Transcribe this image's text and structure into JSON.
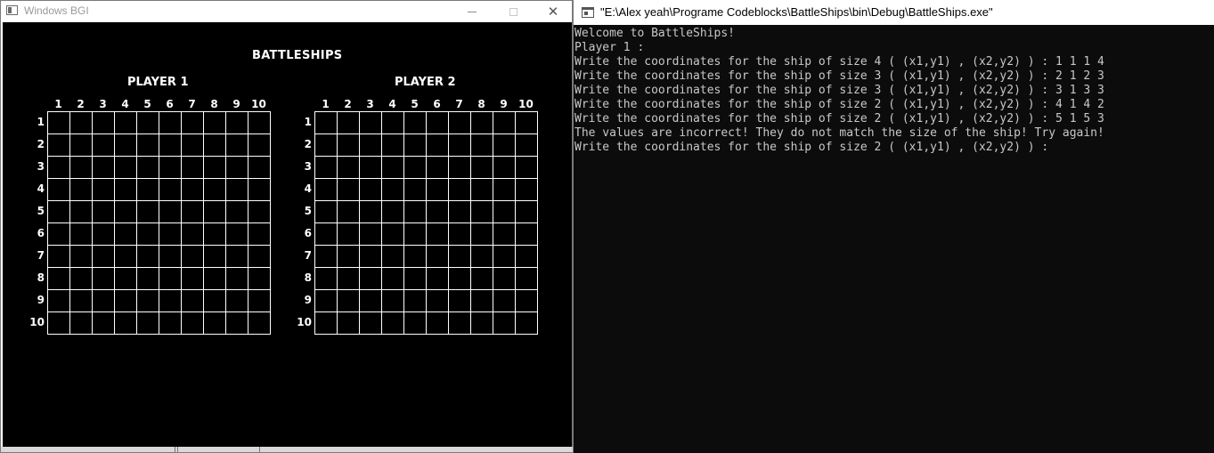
{
  "bgi_window": {
    "title": "Windows BGI",
    "controls": {
      "minimize": "—",
      "maximize": "☐",
      "close": "✕"
    },
    "game_title": "BATTLESHIPS",
    "players": [
      {
        "label": "PLAYER 1"
      },
      {
        "label": "PLAYER 2"
      }
    ],
    "column_numbers": [
      "1",
      "2",
      "3",
      "4",
      "5",
      "6",
      "7",
      "8",
      "9",
      "10"
    ],
    "row_numbers": [
      "1",
      "2",
      "3",
      "4",
      "5",
      "6",
      "7",
      "8",
      "9",
      "10"
    ],
    "colors": {
      "background": "#000000",
      "grid": "#ffffff",
      "text": "#ffffff"
    }
  },
  "console_window": {
    "title": "\"E:\\Alex yeah\\Programe Codeblocks\\BattleShips\\bin\\Debug\\BattleShips.exe\"",
    "lines": [
      "Welcome to BattleShips!",
      "Player 1 :",
      "Write the coordinates for the ship of size 4 ( (x1,y1) , (x2,y2) ) : 1 1 1 4",
      "Write the coordinates for the ship of size 3 ( (x1,y1) , (x2,y2) ) : 2 1 2 3",
      "Write the coordinates for the ship of size 3 ( (x1,y1) , (x2,y2) ) : 3 1 3 3",
      "Write the coordinates for the ship of size 2 ( (x1,y1) , (x2,y2) ) : 4 1 4 2",
      "Write the coordinates for the ship of size 2 ( (x1,y1) , (x2,y2) ) : 5 1 5 3",
      "The values are incorrect! They do not match the size of the ship! Try again!",
      "Write the coordinates for the ship of size 2 ( (x1,y1) , (x2,y2) ) :"
    ],
    "colors": {
      "background": "#0c0c0c",
      "text": "#c8c8c8"
    }
  }
}
